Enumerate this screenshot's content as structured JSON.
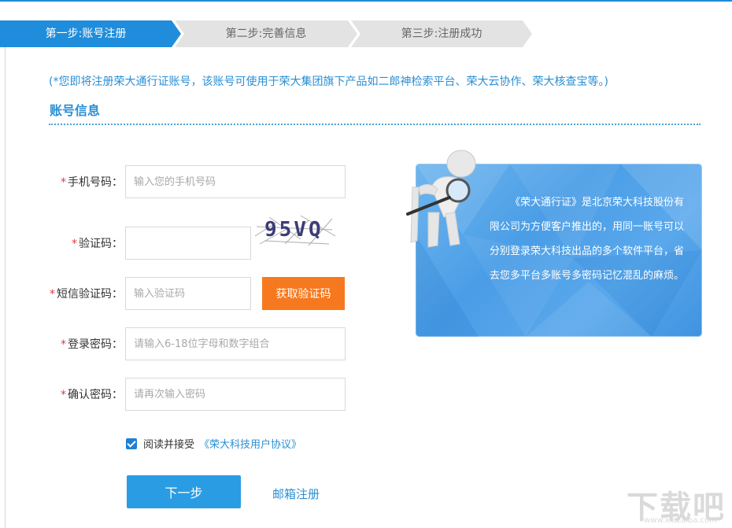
{
  "steps": [
    {
      "label": "第一步:账号注册",
      "active": true
    },
    {
      "label": "第二步:完善信息",
      "active": false
    },
    {
      "label": "第三步:注册成功",
      "active": false
    }
  ],
  "notice": "(*您即将注册荣大通行证账号，该账号可使用于荣大集团旗下产品如二郎神检索平台、荣大云协作、荣大核查宝等。)",
  "section_title": "账号信息",
  "form": {
    "required_mark": "*",
    "phone": {
      "label": "手机号码：",
      "placeholder": "输入您的手机号码",
      "value": ""
    },
    "captcha": {
      "label": "验证码：",
      "placeholder": "",
      "value": "",
      "image_text": "95VQ"
    },
    "sms": {
      "label": "短信验证码：",
      "placeholder": "输入验证码",
      "value": "",
      "button": "获取验证码"
    },
    "password": {
      "label": "登录密码：",
      "placeholder": "请输入6-18位字母和数字组合",
      "value": ""
    },
    "confirm": {
      "label": "确认密码：",
      "placeholder": "请再次输入密码",
      "value": ""
    },
    "agree_text": "阅读并接受",
    "agree_link": "《荣大科技用户协议》",
    "agree_checked": true,
    "next_button": "下一步",
    "email_register": "邮箱注册"
  },
  "promo": {
    "text": "《荣大通行证》是北京荣大科技股份有限公司为方便客户推出的，用同一账号可以分别登录荣大科技出品的多个软件平台，省去您多平台多账号多密码记忆混乱的麻烦。"
  },
  "watermark": {
    "text": "下载吧",
    "url": "www.xiazaiba.com"
  },
  "colors": {
    "accent": "#2a8fd3",
    "step_active": "#1f8ddb",
    "step_inactive": "#e3e3e3",
    "sms_button": "#f7791f",
    "next_button": "#2a9ce3",
    "required": "#e23a3a"
  },
  "icons": [
    "checkbox-checked-icon",
    "magnifier-figure-icon"
  ]
}
